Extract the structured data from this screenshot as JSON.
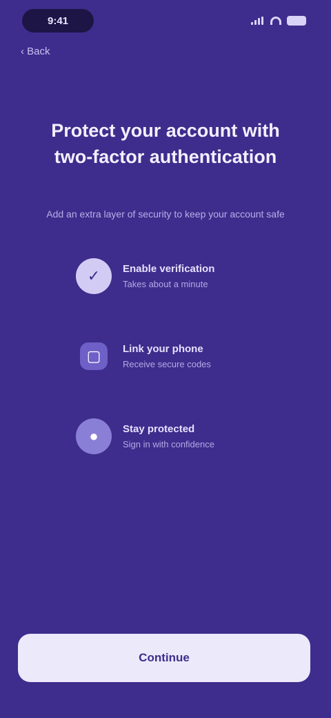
{
  "status_bar": {
    "time": "9:41"
  },
  "header": {
    "back_label": "‹ Back"
  },
  "title": "Protect your account with two-factor authentication",
  "subtitle": "Add an extra layer of security to keep your account safe",
  "steps": [
    {
      "icon": "shield-icon",
      "glyph": "✓",
      "title": "Enable verification",
      "description": "Takes about a minute"
    },
    {
      "icon": "phone-icon",
      "glyph": "▢",
      "title": "Link your phone",
      "description": "Receive secure codes"
    },
    {
      "icon": "lock-icon",
      "glyph": "●",
      "title": "Stay protected",
      "description": "Sign in with confidence"
    }
  ],
  "cta": {
    "label": "Continue"
  },
  "colors": {
    "background": "#3e2d8c",
    "button": "#ece9fb"
  }
}
